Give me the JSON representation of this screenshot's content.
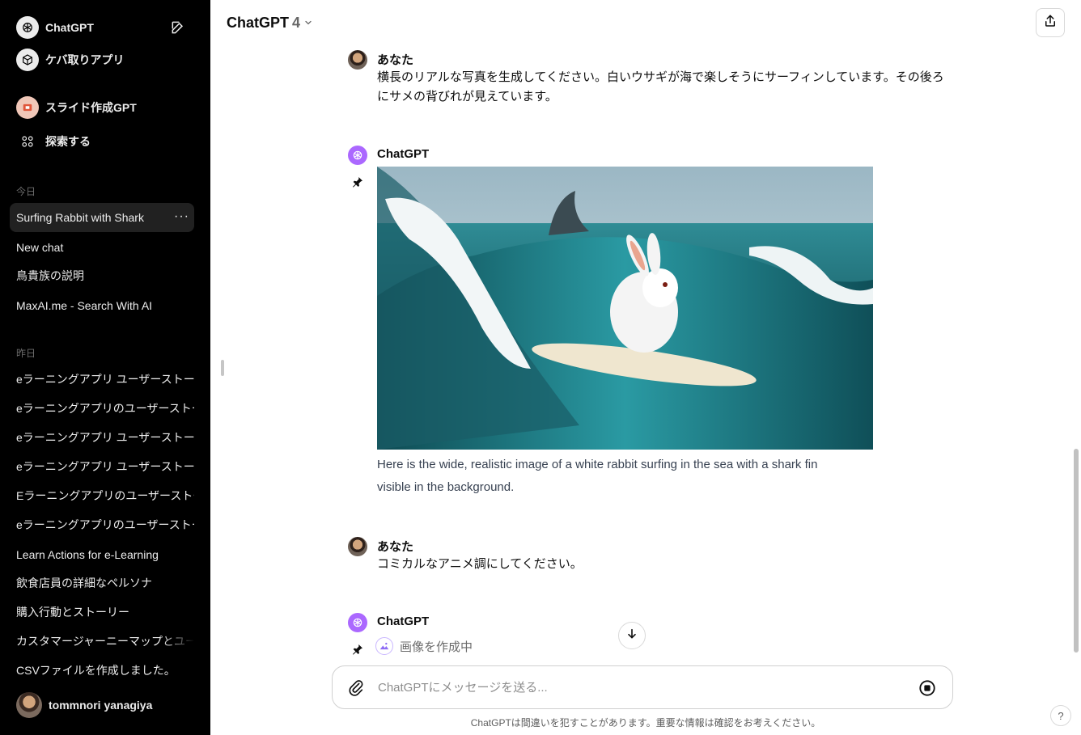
{
  "sidebar": {
    "top": [
      {
        "label": "ChatGPT",
        "icon": "openai-logo-icon"
      },
      {
        "label": "ケバ取りアプリ",
        "icon": "cube-icon"
      },
      {
        "label": "スライド作成GPT",
        "icon": "slide-gpt-icon"
      },
      {
        "label": "探索する",
        "icon": "grid-dots-icon"
      }
    ],
    "today_label": "今日",
    "today": [
      {
        "label": "Surfing Rabbit with Shark",
        "active": true
      },
      {
        "label": "New chat"
      },
      {
        "label": "鳥貴族の説明"
      },
      {
        "label": "MaxAI.me - Search With AI"
      }
    ],
    "yesterday_label": "昨日",
    "yesterday": [
      {
        "label": "eラーニングアプリ ユーザーストーリー"
      },
      {
        "label": "eラーニングアプリのユーザーストーリー"
      },
      {
        "label": "eラーニングアプリ ユーザーストーリー"
      },
      {
        "label": "eラーニングアプリ ユーザーストーリー"
      },
      {
        "label": "Eラーニングアプリのユーザーストーリー"
      },
      {
        "label": "eラーニングアプリのユーザーストーリー"
      },
      {
        "label": "Learn Actions for e-Learning"
      },
      {
        "label": "飲食店員の詳細なペルソナ"
      },
      {
        "label": "購入行動とストーリー"
      },
      {
        "label": "カスタマージャーニーマップとユーザーストー"
      },
      {
        "label": "CSVファイルを作成しました。"
      }
    ],
    "user_name": "tommnori yanagiya"
  },
  "header": {
    "model": "ChatGPT",
    "version": "4"
  },
  "messages": [
    {
      "author": "あなた",
      "text_line1": "横長のリアルな写真を生成してください。白いウサギが海で楽しそうにサーフィンしています。その後ろ",
      "text_line2": "にサメの背びれが見えています。"
    },
    {
      "author": "ChatGPT",
      "text_line1": "Here is the wide, realistic image of a white rabbit surfing in the sea with a shark fin",
      "text_line2": "visible in the background."
    },
    {
      "author": "あなた",
      "text_line1": "コミカルなアニメ調にしてください。"
    },
    {
      "author": "ChatGPT",
      "status": "画像を作成中"
    }
  ],
  "composer": {
    "placeholder": "ChatGPTにメッセージを送る..."
  },
  "disclaimer": "ChatGPTは間違いを犯すことがあります。重要な情報は確認をお考えください。",
  "help_label": "?",
  "colors": {
    "sidebar_bg": "#000000",
    "gpt_avatar": "#ab68ff",
    "text": "#0d0d0d"
  }
}
